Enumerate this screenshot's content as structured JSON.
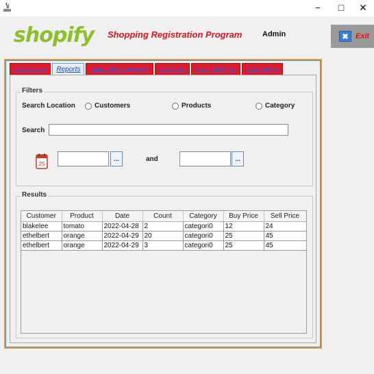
{
  "window": {
    "minimize": "−",
    "maximize": "□",
    "close": "✕"
  },
  "header": {
    "logo": "shopify",
    "title": "Shopping Registration Program",
    "user": "Admin",
    "exit_label": "Exit",
    "exit_icon_glyph": "✖"
  },
  "colors": {
    "accent_red": "#e0141c",
    "logo_green": "#8dbf2a",
    "tab_red": "#e8161e",
    "frame_orange": "#e09a3a"
  },
  "tabs": [
    {
      "label": "Customers"
    },
    {
      "label": "Reports"
    },
    {
      "label": "Sales Management"
    },
    {
      "label": "Products"
    },
    {
      "label": "User Settings"
    },
    {
      "label": "Categories"
    }
  ],
  "active_tab": "Reports",
  "filters": {
    "legend": "Filters",
    "search_location_label": "Search Location",
    "radio_options": [
      "Customers",
      "Products",
      "Category"
    ],
    "search_label": "Search",
    "search_value": "",
    "calendar_day": "25",
    "date_from_value": "",
    "date_to_value": "",
    "picker_label": "...",
    "and_label": "and"
  },
  "results": {
    "legend": "Results",
    "columns": [
      "Customer",
      "Product",
      "Date",
      "Count",
      "Category",
      "Buy Price",
      "Sell Price"
    ],
    "rows": [
      [
        "blakelee",
        "tomato",
        "2022-04-28",
        "2",
        "categori0",
        "12",
        "24"
      ],
      [
        "ethelbert",
        "orange",
        "2022-04-29",
        "20",
        "categori0",
        "25",
        "45"
      ],
      [
        "ethelbert",
        "orange",
        "2022-04-29",
        "3",
        "categori0",
        "25",
        "45"
      ]
    ]
  }
}
